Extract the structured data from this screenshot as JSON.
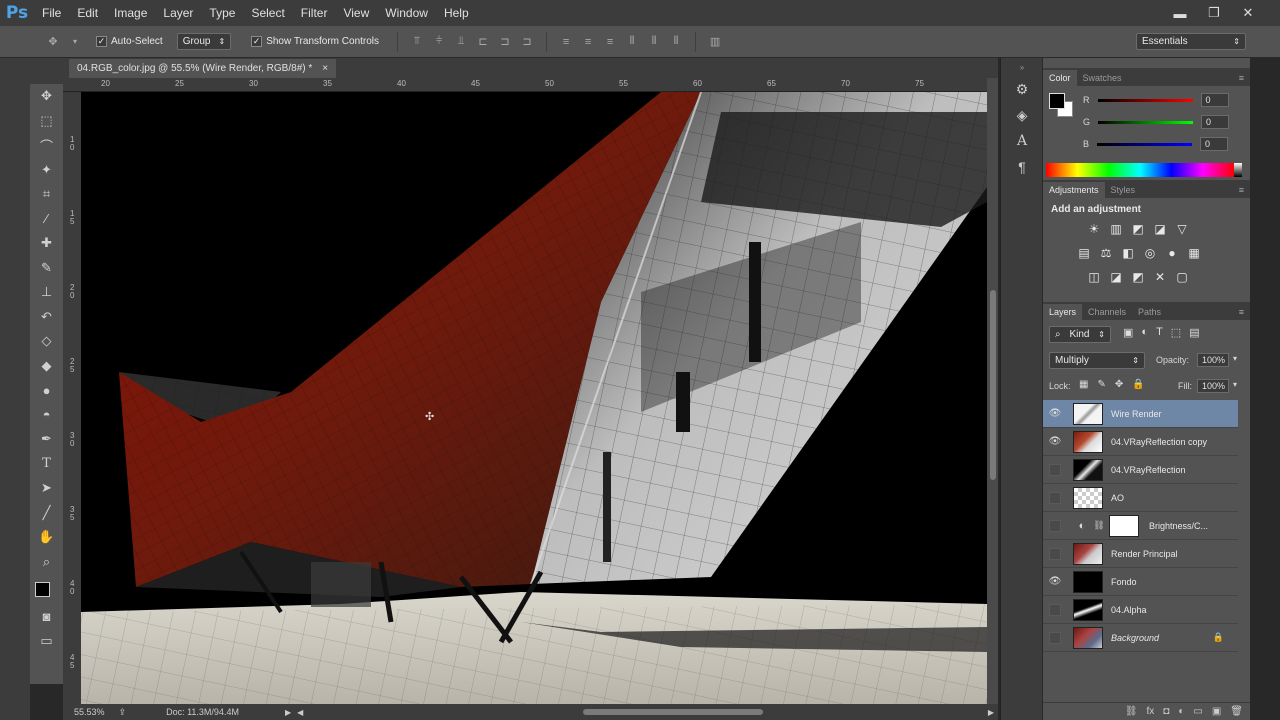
{
  "app": {
    "logo": "Ps"
  },
  "menu": [
    "File",
    "Edit",
    "Image",
    "Layer",
    "Type",
    "Select",
    "Filter",
    "View",
    "Window",
    "Help"
  ],
  "window_controls": {
    "minimize": "▬",
    "restore": "❐",
    "close": "✕"
  },
  "options": {
    "auto_select_label": "Auto-Select",
    "auto_select_value": "Group",
    "show_transform_label": "Show Transform Controls",
    "workspace": "Essentials"
  },
  "document": {
    "tab_title": "04.RGB_color.jpg @ 55.5% (Wire Render, RGB/8#) *",
    "tab_close": "×",
    "ruler_top": [
      "20",
      "25",
      "30",
      "35",
      "40",
      "45",
      "50",
      "55",
      "60",
      "65",
      "70",
      "75",
      "80"
    ],
    "ruler_left": [
      "1 0",
      "1 5",
      "2 0",
      "2 5",
      "3 0",
      "3 5",
      "4 0",
      "4 5"
    ],
    "zoom": "55.53%",
    "doc_info": "Doc: 11.3M/94.4M"
  },
  "color_panel": {
    "tabs": [
      "Color",
      "Swatches"
    ],
    "channels": [
      {
        "label": "R",
        "value": "0",
        "gradient": "#ff0000"
      },
      {
        "label": "G",
        "value": "0",
        "gradient": "#00ff00"
      },
      {
        "label": "B",
        "value": "0",
        "gradient": "#0000ff"
      }
    ]
  },
  "adjustments_panel": {
    "tabs": [
      "Adjustments",
      "Styles"
    ],
    "heading": "Add an adjustment",
    "row1": [
      "☀",
      "▥",
      "◩",
      "◪",
      "▽"
    ],
    "row2": [
      "▤",
      "⚖",
      "◧",
      "◎",
      "●",
      "▦"
    ],
    "row3": [
      "◫",
      "◪",
      "◩",
      "✕",
      "▢"
    ]
  },
  "layers_panel": {
    "tabs": [
      "Layers",
      "Channels",
      "Paths"
    ],
    "filter_kind": "Kind",
    "blend_mode": "Multiply",
    "opacity_label": "Opacity:",
    "opacity_value": "100%",
    "lock_label": "Lock:",
    "fill_label": "Fill:",
    "fill_value": "100%",
    "layers": [
      {
        "name": "Wire Render",
        "visible": true,
        "selected": true
      },
      {
        "name": "04.VRayReflection copy",
        "visible": true,
        "selected": false
      },
      {
        "name": "04.VRayReflection",
        "visible": false,
        "selected": false
      },
      {
        "name": "AO",
        "visible": false,
        "selected": false
      },
      {
        "name": "Brightness/C...",
        "visible": false,
        "selected": false
      },
      {
        "name": "Render Principal",
        "visible": false,
        "selected": false
      },
      {
        "name": "Fondo",
        "visible": true,
        "selected": false
      },
      {
        "name": "04.Alpha",
        "visible": false,
        "selected": false
      },
      {
        "name": "Background",
        "visible": false,
        "selected": false
      }
    ],
    "footer_icons": [
      "⛓",
      "fx",
      "◘",
      "◐",
      "▭",
      "▣",
      "🗑"
    ]
  },
  "colors": {
    "ps_blue": "#4fa3e8",
    "selected_layer": "#6f87a6",
    "panel_bg": "#535353",
    "dark_bg": "#3c3c3c"
  }
}
